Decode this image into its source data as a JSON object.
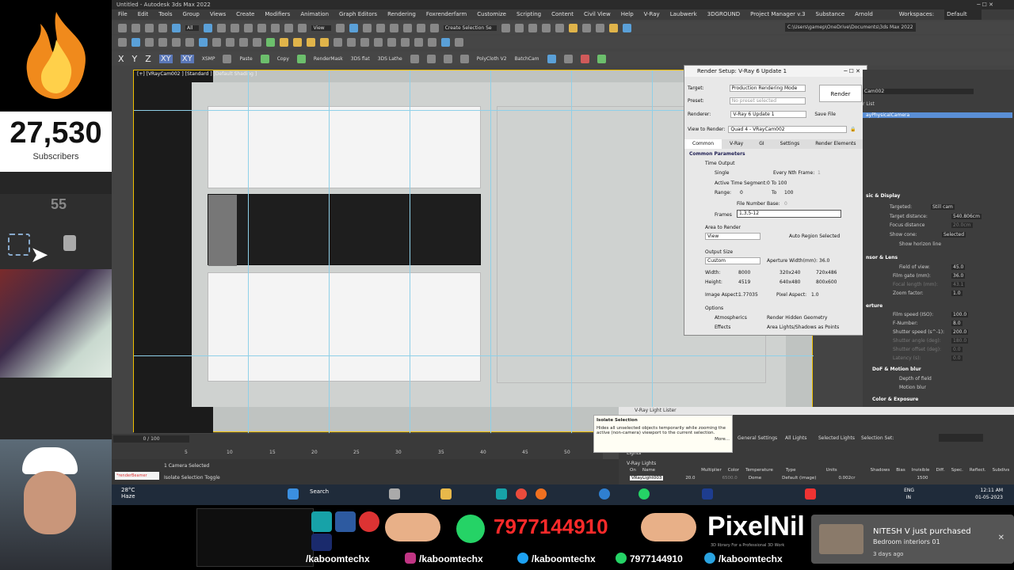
{
  "overlay": {
    "subscriber_count": "27,530",
    "subscriber_label": "Subscribers",
    "small_counter": "55"
  },
  "app": {
    "title": "Untitled - Autodesk 3ds Max 2022",
    "workspace_label": "Workspaces:",
    "workspace_value": "Default",
    "menu": [
      "File",
      "Edit",
      "Tools",
      "Group",
      "Views",
      "Create",
      "Modifiers",
      "Animation",
      "Graph Editors",
      "Rendering",
      "Foxrenderfarm",
      "Customize",
      "Scripting",
      "Content",
      "Civil View",
      "Help",
      "V-Ray",
      "Laubwerk",
      "3DGROUND",
      "Project Manager v.3",
      "Substance",
      "Arnold"
    ],
    "toolbar1": {
      "filter": "All",
      "view": "View",
      "selection_set": "Create Selection Se"
    },
    "project_path": "C:\\Users\\gamep\\OneDrive\\Documents\\3ds Max 2022",
    "toolbar3": [
      "X",
      "Y",
      "Z",
      "XY",
      "XY",
      "XSMP",
      "Paste",
      "Copy",
      "RenderMask",
      "3DS flat",
      "3DS Lathe",
      "PolyCloth V2",
      "BatchCam"
    ],
    "viewport_label": "[+] [VRayCam002 ] [Standard ] [Default Shading ]"
  },
  "render_setup": {
    "title": "Render Setup: V-Ray 6 Update 1",
    "target_label": "Target:",
    "target_value": "Production Rendering Mode",
    "preset_label": "Preset:",
    "preset_value": "No preset selected",
    "renderer_label": "Renderer:",
    "renderer_value": "V-Ray 6 Update 1",
    "save_file": "Save File",
    "view_label": "View to Render:",
    "view_value": "Quad 4 - VRayCam002",
    "render_button": "Render",
    "tabs": [
      "Common",
      "V-Ray",
      "GI",
      "Settings",
      "Render Elements"
    ],
    "section_common": "Common Parameters",
    "time_output": "Time Output",
    "single": "Single",
    "every_nth": "Every Nth Frame:",
    "every_nth_value": "1",
    "active_segment": "Active Time Segment:",
    "active_segment_value": "0 To 100",
    "range": "Range:",
    "range_from": "0",
    "range_to_label": "To",
    "range_to": "100",
    "file_number_base": "File Number Base:",
    "file_number_base_value": "0",
    "frames": "Frames",
    "frames_value": "1,3,5-12",
    "area_to_render": "Area to Render",
    "area_value": "View",
    "auto_region": "Auto Region Selected",
    "output_size": "Output Size",
    "output_preset": "Custom",
    "aperture_label": "Aperture Width(mm):",
    "aperture_value": "36.0",
    "width_label": "Width:",
    "width_value": "8000",
    "height_label": "Height:",
    "height_value": "4519",
    "preset_sizes": [
      "320x240",
      "720x486",
      "640x480",
      "800x600"
    ],
    "image_aspect_label": "Image Aspect:",
    "image_aspect_value": "1.77035",
    "pixel_aspect_label": "Pixel Aspect:",
    "pixel_aspect_value": "1.0",
    "options": "Options",
    "atmospherics": "Atmospherics",
    "hidden_geometry": "Render Hidden Geometry",
    "effects": "Effects",
    "area_lights": "Area Lights/Shadows as Points"
  },
  "command_panel": {
    "object_name": "Cam002",
    "list_label": "r List",
    "selected_item": "ayPhysicalCamera",
    "sec_basic": "sic & Display",
    "targeted": "Targeted:",
    "targeted_value": "Still cam",
    "target_distance": "Target distance:",
    "target_distance_value": "540.806cm",
    "focus_distance": "Focus distance",
    "focus_distance_value": "20.0cm",
    "show_cone": "Show cone:",
    "show_cone_value": "Selected",
    "show_horizon": "Show horizon line",
    "sec_sensor": "nsor & Lens",
    "fov": "Field of view:",
    "fov_value": "45.0",
    "film_gate": "Film gate (mm):",
    "film_gate_value": "36.0",
    "focal_length": "Focal length (mm):",
    "focal_length_value": "43.1",
    "zoom": "Zoom factor:",
    "zoom_value": "1.0",
    "sec_aperture": "erture",
    "film_speed": "Film speed (ISO):",
    "film_speed_value": "100.0",
    "fnumber": "F-Number:",
    "fnumber_value": "8.0",
    "shutter_speed": "Shutter speed (s^-1):",
    "shutter_speed_value": "200.0",
    "shutter_angle": "Shutter angle (deg):",
    "shutter_angle_value": "180.0",
    "shutter_offset": "Shutter offset (deg):",
    "shutter_offset_value": "0.0",
    "latency": "Latency (s):",
    "latency_value": "0.0",
    "sec_dof": "DoF & Motion blur",
    "depth_of_field": "Depth of field",
    "motion_blur": "Motion blur",
    "sec_color": "Color & Exposure"
  },
  "timeline": {
    "frame_display": "0 / 100",
    "ticks": [
      "5",
      "10",
      "15",
      "20",
      "25",
      "30",
      "35",
      "40",
      "45",
      "50"
    ]
  },
  "status": {
    "selection": "1 Camera Selected",
    "prompt": "Isolate Selection Toggle",
    "maxscript": "*renderBeamer"
  },
  "tooltip": {
    "title": "Isolate Selection",
    "text": "Hides all unselected objects temporarily while zooming the active (non-camera) viewport to the current selection.",
    "more": "More..."
  },
  "light_lister": {
    "title": "V-Ray Light Lister",
    "general": "General Settings",
    "all_lights": "All Lights",
    "selected_lights": "Selected Lights",
    "selection_set": "Selection Set:",
    "lights_header": "Lights",
    "vray_lights": "V-Ray Lights",
    "columns": [
      "On",
      "Name",
      "Multiplier",
      "Color",
      "Temperature",
      "Type",
      "Units",
      "Shadows",
      "Bias",
      "Invisible",
      "Diff.",
      "Spec.",
      "Reflect.",
      "Subdivs"
    ],
    "row": {
      "name": "VRayLight003",
      "multiplier": "20.0",
      "temperature": "6500.0",
      "type": "Dome",
      "units": "Default (image)",
      "bias": "0.002cr",
      "subdivs": "1500"
    }
  },
  "taskbar": {
    "temp": "28°C",
    "weather": "Haze",
    "search": "Search",
    "lang": "ENG",
    "region": "IN",
    "time": "12:11 AM",
    "date": "01-05-2023"
  },
  "promo": {
    "phone": "7977144910",
    "brand": "PixelNil",
    "brand_sub": "3D library For a Professional 3D Work",
    "handle1": "/kaboomtechx",
    "handle2": "/kaboomtechx",
    "handle3": "/kaboomtechx",
    "phone_small": "7977144910",
    "handle4": "/kaboomtechx",
    "notif_title": "NITESH V just purchased",
    "notif_item": "Bedroom interiors 01",
    "notif_time": "3 days ago"
  }
}
